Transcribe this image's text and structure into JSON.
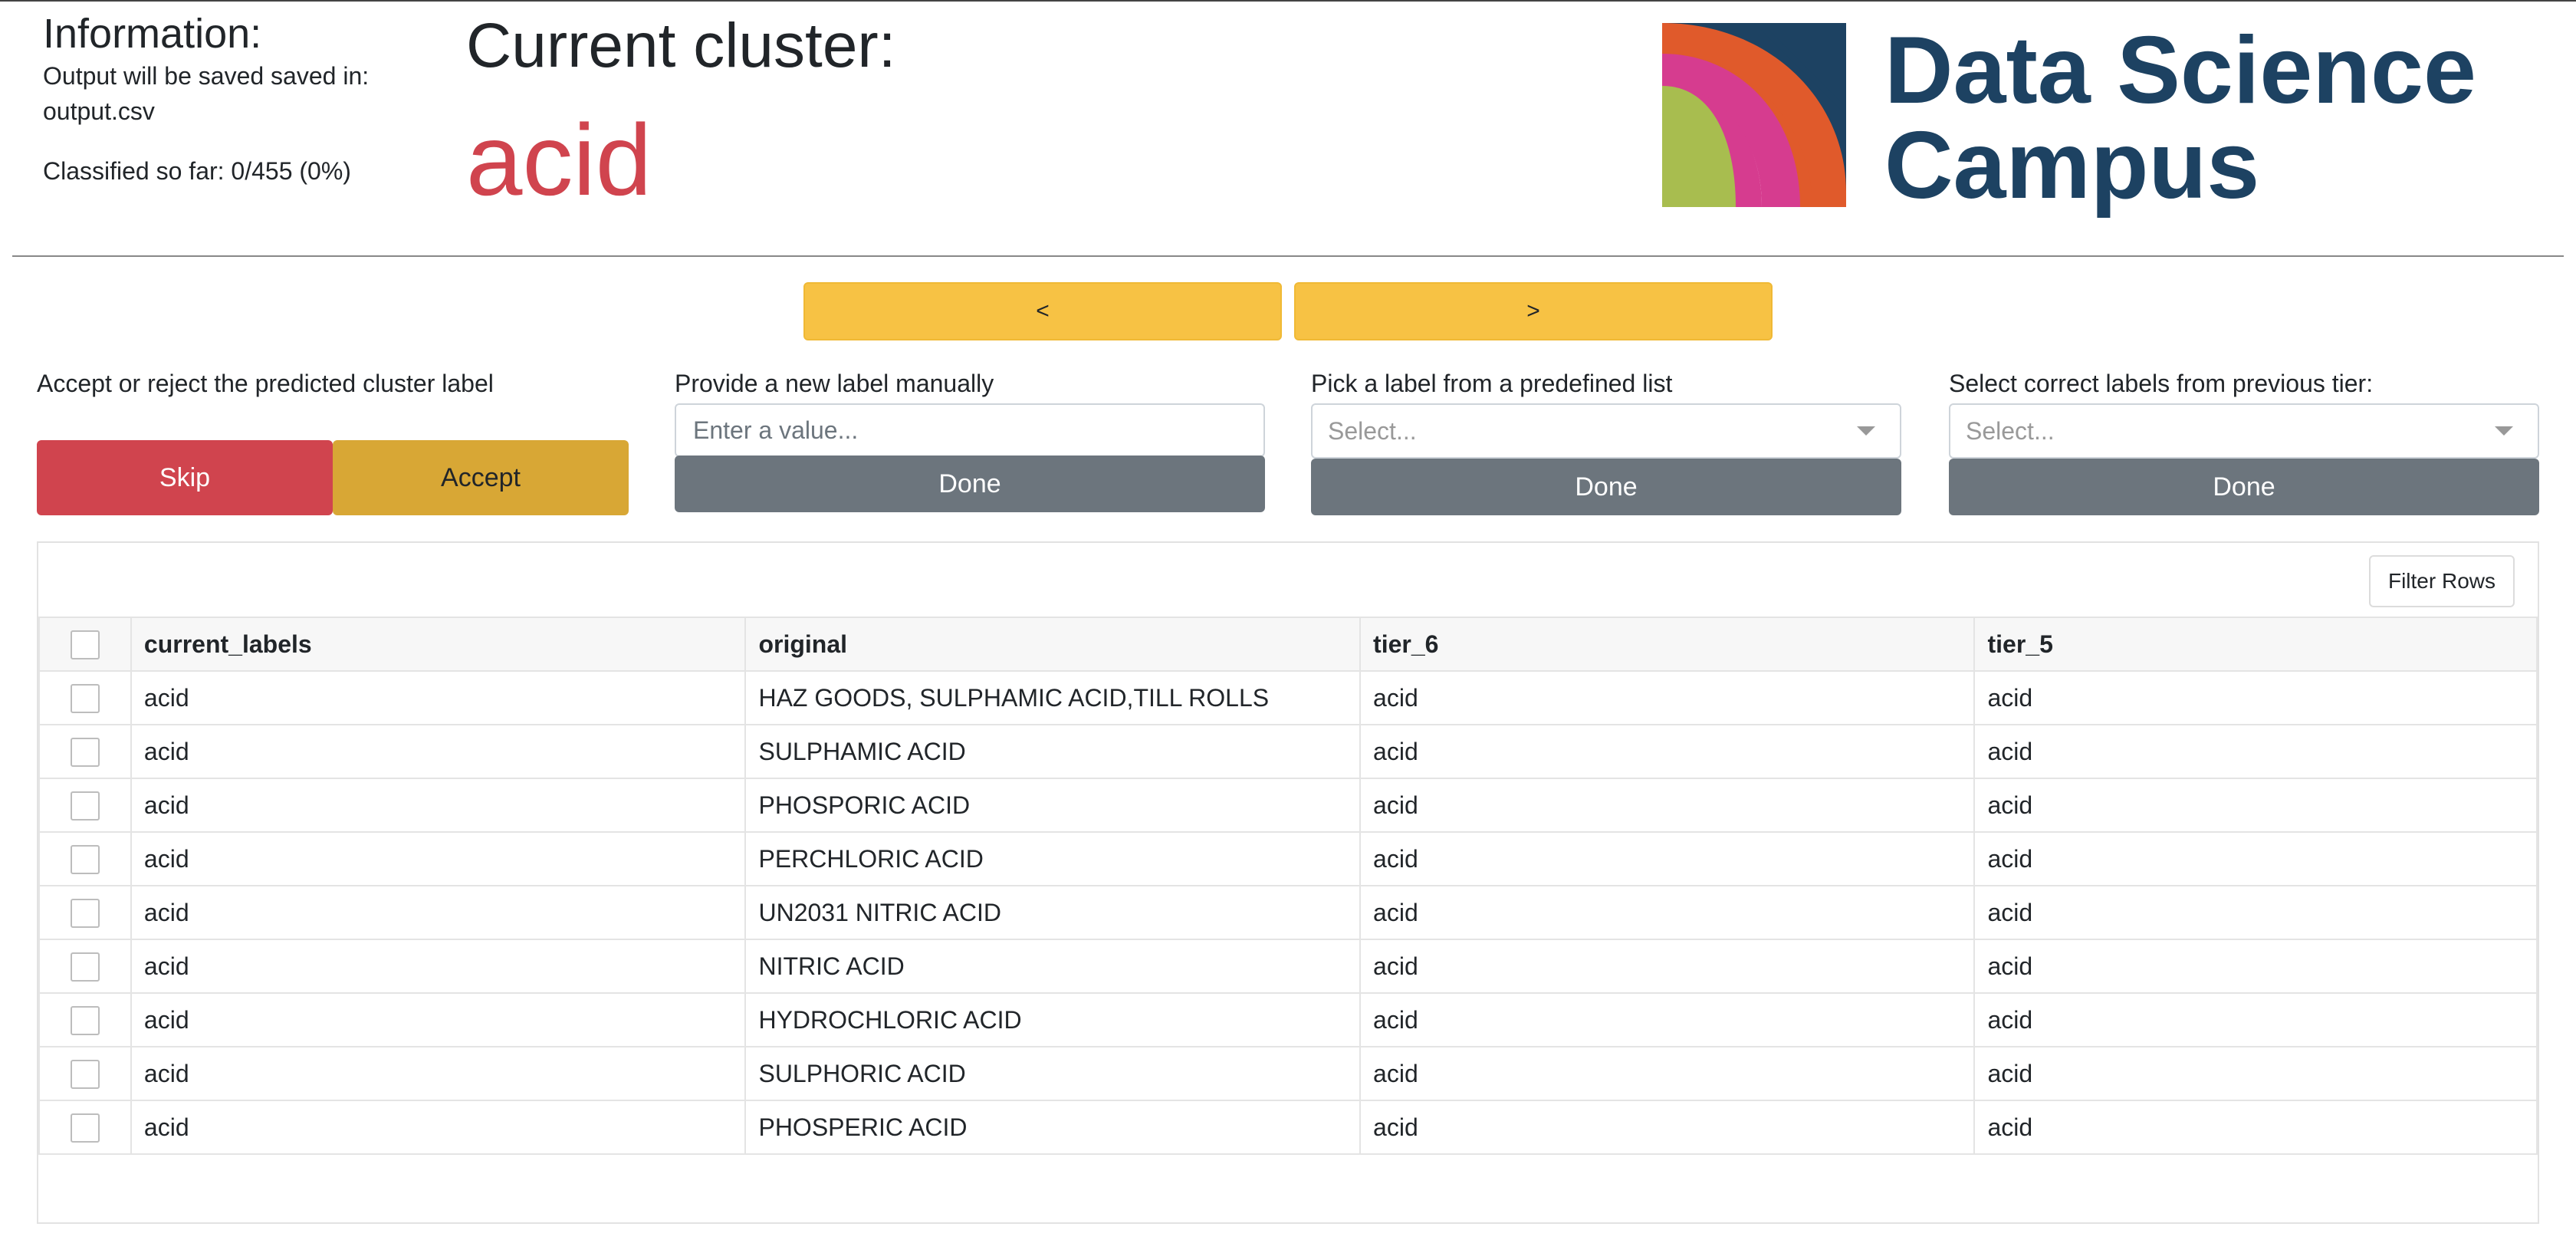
{
  "info": {
    "heading": "Information:",
    "output_prefix": "Output will be saved saved in:",
    "output_file": "output.csv",
    "progress": "Classified so far: 0/455 (0%)"
  },
  "cluster": {
    "heading": "Current cluster:",
    "name": "acid"
  },
  "logo": {
    "line1": "Data Science",
    "line2": "Campus",
    "colors": {
      "navy": "#1d4262",
      "orange": "#e05a2b",
      "pink": "#d63c8f",
      "green": "#a8bd4f"
    }
  },
  "nav": {
    "prev_label": "<",
    "next_label": ">"
  },
  "controls": {
    "accept_reject": {
      "label": "Accept or reject the predicted cluster label",
      "skip_label": "Skip",
      "accept_label": "Accept"
    },
    "manual": {
      "label": "Provide a new label manually",
      "placeholder": "Enter a value...",
      "done_label": "Done"
    },
    "predefined": {
      "label": "Pick a label from a predefined list",
      "placeholder": "Select...",
      "done_label": "Done"
    },
    "previous_tier": {
      "label": "Select correct labels from previous tier:",
      "placeholder": "Select...",
      "done_label": "Done"
    }
  },
  "table": {
    "filter_label": "Filter Rows",
    "columns": [
      "current_labels",
      "original",
      "tier_6",
      "tier_5"
    ],
    "rows": [
      [
        "acid",
        "HAZ GOODS, SULPHAMIC ACID,TILL ROLLS",
        "acid",
        "acid"
      ],
      [
        "acid",
        "SULPHAMIC ACID",
        "acid",
        "acid"
      ],
      [
        "acid",
        "PHOSPORIC ACID",
        "acid",
        "acid"
      ],
      [
        "acid",
        "PERCHLORIC ACID",
        "acid",
        "acid"
      ],
      [
        "acid",
        "UN2031 NITRIC ACID",
        "acid",
        "acid"
      ],
      [
        "acid",
        "NITRIC ACID",
        "acid",
        "acid"
      ],
      [
        "acid",
        "HYDROCHLORIC ACID",
        "acid",
        "acid"
      ],
      [
        "acid",
        "SULPHORIC ACID",
        "acid",
        "acid"
      ],
      [
        "acid",
        "PHOSPERIC ACID",
        "acid",
        "acid"
      ]
    ]
  },
  "colors": {
    "skip": "#d0444e",
    "accept": "#d8a735",
    "nav": "#f7c244",
    "done": "#6c757d",
    "cluster_name": "#d0444e"
  }
}
